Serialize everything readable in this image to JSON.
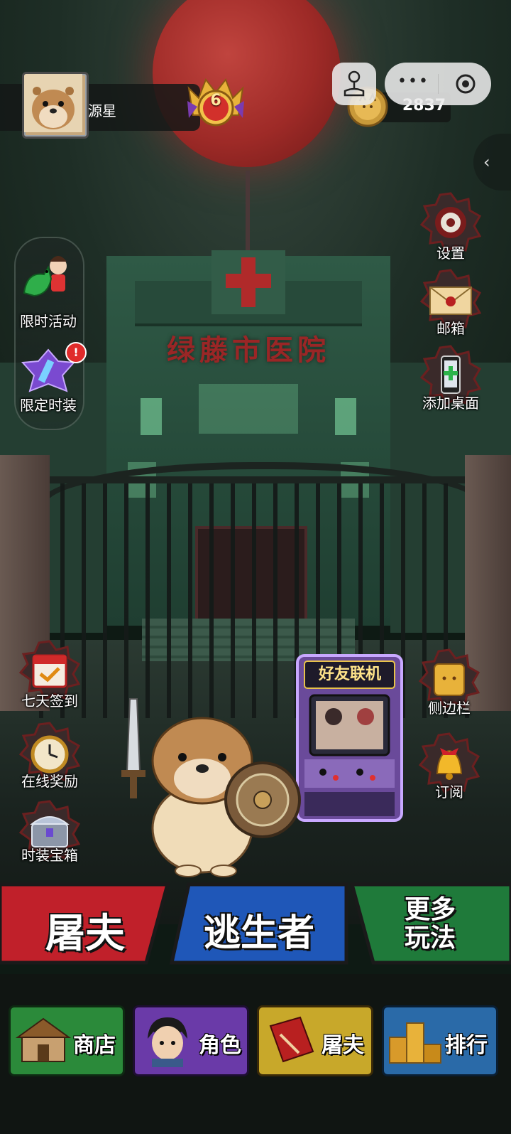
{
  "profile": {
    "name": "源星",
    "level": "6"
  },
  "currency": {
    "coins": "2837"
  },
  "scene": {
    "hospital_sign": "绿藤市医院"
  },
  "left_menu": [
    {
      "label": "限时活动"
    },
    {
      "label": "限定时装"
    },
    {
      "label": "七天签到"
    },
    {
      "label": "在线奖励"
    },
    {
      "label": "时装宝箱"
    }
  ],
  "right_menu": [
    {
      "label": "设置"
    },
    {
      "label": "邮箱"
    },
    {
      "label": "添加桌面"
    },
    {
      "label": "侧边栏"
    },
    {
      "label": "订阅"
    }
  ],
  "badges": {
    "limited_outfit_alert": "!"
  },
  "arcade": {
    "label": "好友联机"
  },
  "modes": {
    "butcher": "屠夫",
    "survivor": "逃生者",
    "more_line1": "更多",
    "more_line2": "玩法"
  },
  "nav": {
    "shop": "商店",
    "role": "角色",
    "butcher": "屠夫",
    "rank": "排行"
  },
  "colors": {
    "butcher_red": "#c0202a",
    "survivor_blue": "#1f57b8",
    "more_green": "#1f7a3a",
    "gold": "#e8b23a"
  }
}
